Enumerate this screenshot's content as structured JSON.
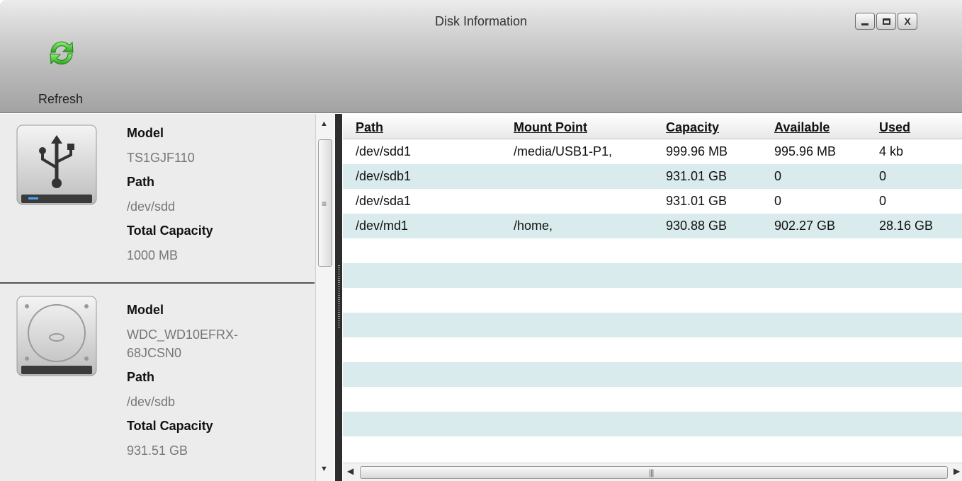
{
  "window": {
    "title": "Disk Information",
    "controls": {
      "minimize": "minimize",
      "maximize": "maximize",
      "close": "X"
    }
  },
  "toolbar": {
    "refresh_label": "Refresh",
    "refresh_icon": "refresh-icon"
  },
  "disks": [
    {
      "icon": "usb-drive-icon",
      "model_label": "Model",
      "model": "TS1GJF110",
      "path_label": "Path",
      "path": "/dev/sdd",
      "capacity_label": "Total Capacity",
      "capacity": "1000 MB"
    },
    {
      "icon": "hard-disk-icon",
      "model_label": "Model",
      "model_line1": "WDC_WD10EFRX-",
      "model_line2": "68JCSN0",
      "path_label": "Path",
      "path": "/dev/sdb",
      "capacity_label": "Total Capacity",
      "capacity": "931.51 GB"
    }
  ],
  "table": {
    "columns": [
      "Path",
      "Mount Point",
      "Capacity",
      "Available",
      "Used"
    ],
    "rows": [
      [
        "/dev/sdd1",
        "/media/USB1-P1,",
        "999.96 MB",
        "995.96 MB",
        "4 kb"
      ],
      [
        "/dev/sdb1",
        "",
        "931.01 GB",
        "0",
        "0"
      ],
      [
        "/dev/sda1",
        "",
        "931.01 GB",
        "0",
        "0"
      ],
      [
        "/dev/md1",
        "/home,",
        "930.88 GB",
        "902.27 GB",
        "28.16 GB"
      ]
    ],
    "stripe_color": "#d9ebec"
  },
  "colors": {
    "splitter": "#2d2d2d",
    "left_panel_bg": "#ececec",
    "refresh_green": "#3dbf2a"
  }
}
